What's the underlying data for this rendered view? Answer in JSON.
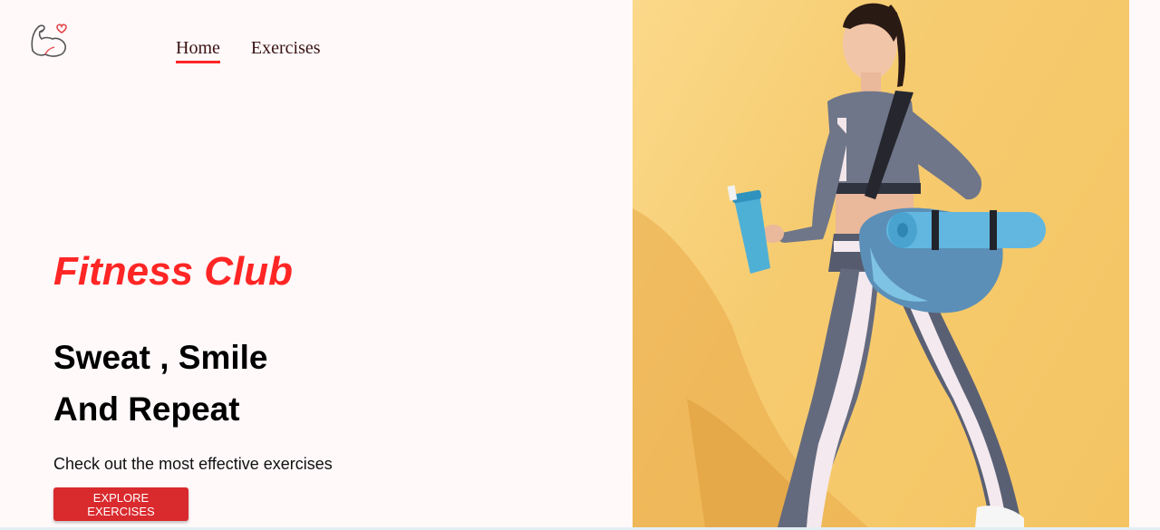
{
  "nav": {
    "items": [
      {
        "label": "Home",
        "active": true
      },
      {
        "label": "Exercises",
        "active": false
      }
    ]
  },
  "hero": {
    "brand": "Fitness Club",
    "headline_line1": "Sweat , Smile",
    "headline_line2": "And Repeat",
    "subtitle": "Check out the most effective exercises",
    "cta_label": "EXPLORE EXERCISES"
  },
  "colors": {
    "accent": "#ff2625",
    "button": "#d92a2e",
    "background": "#fff9fa",
    "image_background": "#f6cb6f"
  },
  "icons": {
    "logo": "flexed-arm-heart-icon"
  }
}
